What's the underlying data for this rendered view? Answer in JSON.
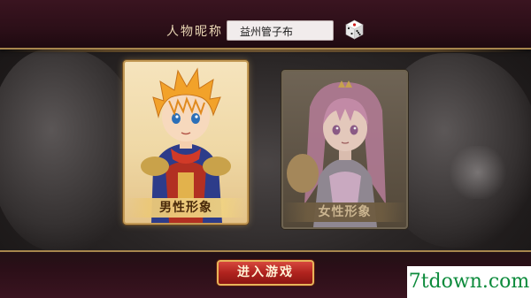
{
  "nickname": {
    "label": "人物昵称",
    "value": "益州管子布",
    "random_icon": "dice-icon"
  },
  "characters": [
    {
      "caption": "男性形象",
      "selected": true
    },
    {
      "caption": "女性形象",
      "selected": false
    }
  ],
  "enter_button": {
    "label": "进入游戏"
  },
  "watermark": {
    "text": "7tdown.com"
  },
  "colors": {
    "band": "#2c0f18",
    "gold_border": "#a7864d",
    "enter_button": "#b0231e",
    "watermark_text": "#0d8b3c"
  }
}
